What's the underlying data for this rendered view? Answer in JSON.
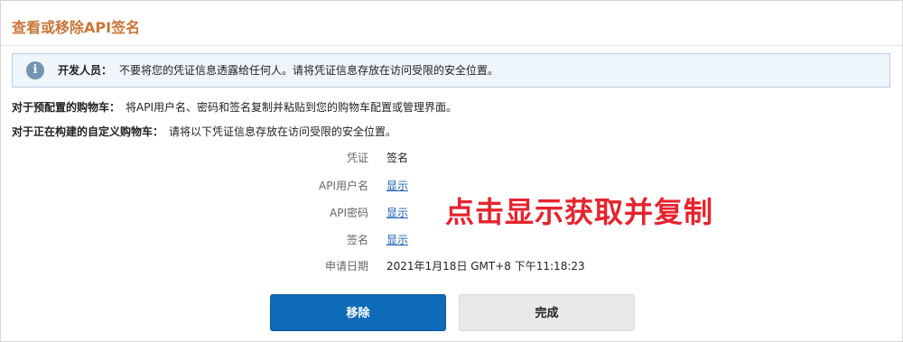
{
  "page": {
    "title": "查看或移除API签名"
  },
  "alert": {
    "icon": "info-icon",
    "lead": "开发人员：",
    "text": "不要将您的凭证信息透露给任何人。请将凭证信息存放在访问受限的安全位置。"
  },
  "instructions": [
    {
      "lead": "对于预配置的购物车：",
      "text": "将API用户名、密码和签名复制并粘贴到您的购物车配置或管理界面。"
    },
    {
      "lead": "对于正在构建的自定义购物车：",
      "text": "请将以下凭证信息存放在访问受限的安全位置。"
    }
  ],
  "credentials": {
    "header_label": "凭证",
    "header_value": "签名",
    "rows": [
      {
        "label": "API用户名",
        "value": "显示"
      },
      {
        "label": "API密码",
        "value": "显示"
      },
      {
        "label": "签名",
        "value": "显示"
      }
    ],
    "date_label": "申请日期",
    "date_value": "2021年1月18日 GMT+8 下午11:18:23"
  },
  "annotation": {
    "text": "点击显示获取并复制",
    "color": "#e6232e"
  },
  "buttons": {
    "remove": "移除",
    "done": "完成"
  },
  "colors": {
    "title": "#c9773a",
    "primary": "#0d6bb8",
    "link": "#1a5fb4",
    "alert_bg": "#eef5fb"
  }
}
